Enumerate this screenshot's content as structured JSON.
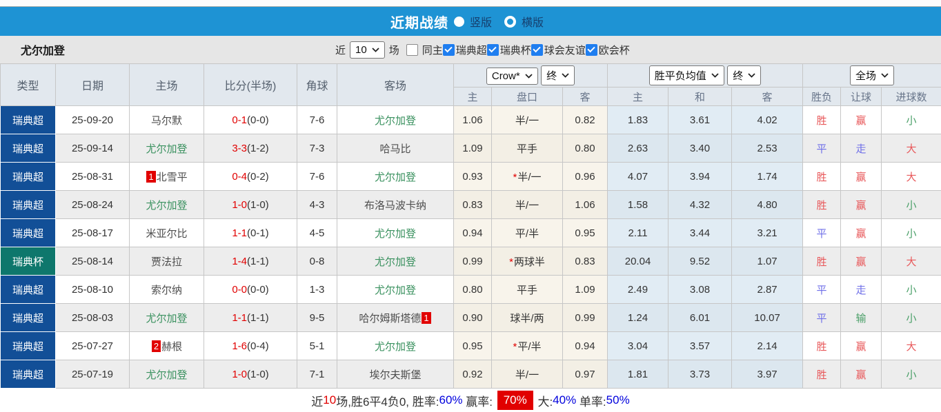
{
  "colors": {
    "bar_blue": "#1e93d4",
    "league_blue": "#124f97",
    "cup_teal": "#0e776c",
    "score_red": "#e10000",
    "team_green": "#3a915f",
    "asia_bg": "#f8f4eb",
    "euro_bg": "#e1ecf4",
    "result_red": "#e8585a",
    "result_blue": "#6f6fe8",
    "result_green": "#4a9f68",
    "checkbox_blue": "#1f7ef0"
  },
  "header": {
    "title": "近期战绩",
    "radio_vertical_label": "竖版",
    "radio_horizontal_label": "横版"
  },
  "filter": {
    "team": "尤尔加登",
    "near_label": "近",
    "near_value": "10",
    "games_label": "场",
    "same_home_label": "同主",
    "leagues": [
      "瑞典超",
      "瑞典杯",
      "球会友谊",
      "欧会杯"
    ]
  },
  "table": {
    "main_headers": [
      "类型",
      "日期",
      "主场",
      "比分(半场)",
      "角球",
      "客场"
    ],
    "selects": {
      "company": "Crow*",
      "state1": "终",
      "wdl": "胜平负均值",
      "state2": "终",
      "scope": "全场"
    },
    "sub_headers": [
      "主",
      "盘口",
      "客",
      "主",
      "和",
      "客",
      "胜负",
      "让球",
      "进球数"
    ],
    "rows": [
      {
        "type": "瑞典超",
        "cup": false,
        "date": "25-09-20",
        "home": {
          "name": "马尔默",
          "green": false,
          "card": "",
          "cardPos": ""
        },
        "score": "0-1",
        "half": "(0-0)",
        "corners": "7-6",
        "away": {
          "name": "尤尔加登",
          "green": true,
          "card": "",
          "cardPos": ""
        },
        "asia": {
          "home": "1.06",
          "star": "",
          "line": "半/一",
          "away": "0.82"
        },
        "europe": [
          "1.83",
          "3.61",
          "4.02"
        ],
        "result": [
          [
            "胜",
            "red"
          ],
          [
            "赢",
            "red"
          ],
          [
            "小",
            "green"
          ]
        ]
      },
      {
        "type": "瑞典超",
        "cup": false,
        "date": "25-09-14",
        "home": {
          "name": "尤尔加登",
          "green": true,
          "card": "",
          "cardPos": ""
        },
        "score": "3-3",
        "half": "(1-2)",
        "corners": "7-3",
        "away": {
          "name": "哈马比",
          "green": false,
          "card": "",
          "cardPos": ""
        },
        "asia": {
          "home": "1.09",
          "star": "",
          "line": "平手",
          "away": "0.80"
        },
        "europe": [
          "2.63",
          "3.40",
          "2.53"
        ],
        "result": [
          [
            "平",
            "blue"
          ],
          [
            "走",
            "blue"
          ],
          [
            "大",
            "red"
          ]
        ]
      },
      {
        "type": "瑞典超",
        "cup": false,
        "date": "25-08-31",
        "home": {
          "name": "北雪平",
          "green": false,
          "card": "1",
          "cardPos": "before"
        },
        "score": "0-4",
        "half": "(0-2)",
        "corners": "7-6",
        "away": {
          "name": "尤尔加登",
          "green": true,
          "card": "",
          "cardPos": ""
        },
        "asia": {
          "home": "0.93",
          "star": "*",
          "line": "半/一",
          "away": "0.96"
        },
        "europe": [
          "4.07",
          "3.94",
          "1.74"
        ],
        "result": [
          [
            "胜",
            "red"
          ],
          [
            "赢",
            "red"
          ],
          [
            "大",
            "red"
          ]
        ]
      },
      {
        "type": "瑞典超",
        "cup": false,
        "date": "25-08-24",
        "home": {
          "name": "尤尔加登",
          "green": true,
          "card": "",
          "cardPos": ""
        },
        "score": "1-0",
        "half": "(1-0)",
        "corners": "4-3",
        "away": {
          "name": "布洛马波卡纳",
          "green": false,
          "card": "",
          "cardPos": ""
        },
        "asia": {
          "home": "0.83",
          "star": "",
          "line": "半/一",
          "away": "1.06"
        },
        "europe": [
          "1.58",
          "4.32",
          "4.80"
        ],
        "result": [
          [
            "胜",
            "red"
          ],
          [
            "赢",
            "red"
          ],
          [
            "小",
            "green"
          ]
        ]
      },
      {
        "type": "瑞典超",
        "cup": false,
        "date": "25-08-17",
        "home": {
          "name": "米亚尔比",
          "green": false,
          "card": "",
          "cardPos": ""
        },
        "score": "1-1",
        "half": "(0-1)",
        "corners": "4-5",
        "away": {
          "name": "尤尔加登",
          "green": true,
          "card": "",
          "cardPos": ""
        },
        "asia": {
          "home": "0.94",
          "star": "",
          "line": "平/半",
          "away": "0.95"
        },
        "europe": [
          "2.11",
          "3.44",
          "3.21"
        ],
        "result": [
          [
            "平",
            "blue"
          ],
          [
            "赢",
            "red"
          ],
          [
            "小",
            "green"
          ]
        ]
      },
      {
        "type": "瑞典杯",
        "cup": true,
        "date": "25-08-14",
        "home": {
          "name": "贾法拉",
          "green": false,
          "card": "",
          "cardPos": ""
        },
        "score": "1-4",
        "half": "(1-1)",
        "corners": "0-8",
        "away": {
          "name": "尤尔加登",
          "green": true,
          "card": "",
          "cardPos": ""
        },
        "asia": {
          "home": "0.99",
          "star": "*",
          "line": "两球半",
          "away": "0.83"
        },
        "europe": [
          "20.04",
          "9.52",
          "1.07"
        ],
        "result": [
          [
            "胜",
            "red"
          ],
          [
            "赢",
            "red"
          ],
          [
            "大",
            "red"
          ]
        ]
      },
      {
        "type": "瑞典超",
        "cup": false,
        "date": "25-08-10",
        "home": {
          "name": "索尔纳",
          "green": false,
          "card": "",
          "cardPos": ""
        },
        "score": "0-0",
        "half": "(0-0)",
        "corners": "1-3",
        "away": {
          "name": "尤尔加登",
          "green": true,
          "card": "",
          "cardPos": ""
        },
        "asia": {
          "home": "0.80",
          "star": "",
          "line": "平手",
          "away": "1.09"
        },
        "europe": [
          "2.49",
          "3.08",
          "2.87"
        ],
        "result": [
          [
            "平",
            "blue"
          ],
          [
            "走",
            "blue"
          ],
          [
            "小",
            "green"
          ]
        ]
      },
      {
        "type": "瑞典超",
        "cup": false,
        "date": "25-08-03",
        "home": {
          "name": "尤尔加登",
          "green": true,
          "card": "",
          "cardPos": ""
        },
        "score": "1-1",
        "half": "(1-1)",
        "corners": "9-5",
        "away": {
          "name": "哈尔姆斯塔德",
          "green": false,
          "card": "1",
          "cardPos": "after"
        },
        "asia": {
          "home": "0.90",
          "star": "",
          "line": "球半/两",
          "away": "0.99"
        },
        "europe": [
          "1.24",
          "6.01",
          "10.07"
        ],
        "result": [
          [
            "平",
            "blue"
          ],
          [
            "输",
            "green"
          ],
          [
            "小",
            "green"
          ]
        ]
      },
      {
        "type": "瑞典超",
        "cup": false,
        "date": "25-07-27",
        "home": {
          "name": "赫根",
          "green": false,
          "card": "2",
          "cardPos": "before"
        },
        "score": "1-6",
        "half": "(0-4)",
        "corners": "5-1",
        "away": {
          "name": "尤尔加登",
          "green": true,
          "card": "",
          "cardPos": ""
        },
        "asia": {
          "home": "0.95",
          "star": "*",
          "line": "平/半",
          "away": "0.94"
        },
        "europe": [
          "3.04",
          "3.57",
          "2.14"
        ],
        "result": [
          [
            "胜",
            "red"
          ],
          [
            "赢",
            "red"
          ],
          [
            "大",
            "red"
          ]
        ]
      },
      {
        "type": "瑞典超",
        "cup": false,
        "date": "25-07-19",
        "home": {
          "name": "尤尔加登",
          "green": true,
          "card": "",
          "cardPos": ""
        },
        "score": "1-0",
        "half": "(1-0)",
        "corners": "7-1",
        "away": {
          "name": "埃尔夫斯堡",
          "green": false,
          "card": "",
          "cardPos": ""
        },
        "asia": {
          "home": "0.92",
          "star": "",
          "line": "半/一",
          "away": "0.97"
        },
        "europe": [
          "1.81",
          "3.73",
          "3.97"
        ],
        "result": [
          [
            "胜",
            "red"
          ],
          [
            "赢",
            "red"
          ],
          [
            "小",
            "green"
          ]
        ]
      }
    ]
  },
  "summary": {
    "segments": [
      {
        "text": "近",
        "style": "dark"
      },
      {
        "text": "10",
        "style": "red"
      },
      {
        "text": "场,胜6平4负0, 胜率:",
        "style": "dark"
      },
      {
        "text": "60%",
        "style": "blue"
      },
      {
        "text": " 赢率: ",
        "style": "dark"
      },
      {
        "text": "70%",
        "style": "redbox"
      },
      {
        "text": " 大:",
        "style": "dark"
      },
      {
        "text": "40%",
        "style": "blue"
      },
      {
        "text": " 单率:",
        "style": "dark"
      },
      {
        "text": "50%",
        "style": "blue"
      }
    ]
  }
}
